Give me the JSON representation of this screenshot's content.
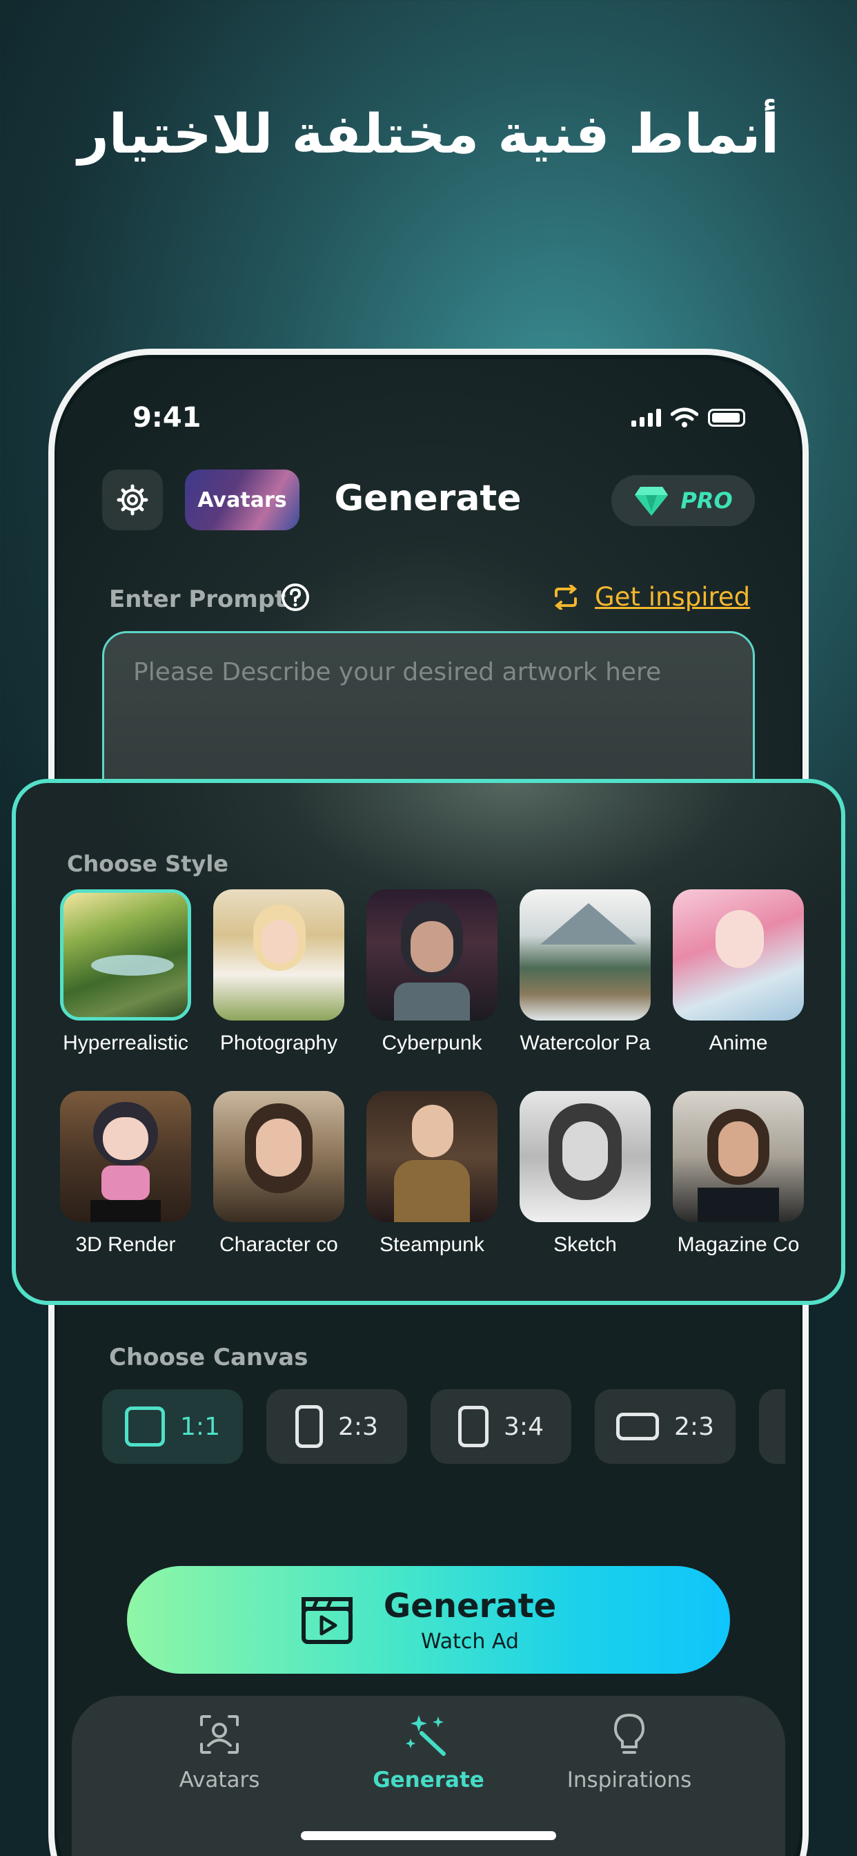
{
  "headline": "أنماط فنية مختلفة للاختيار",
  "status": {
    "time": "9:41"
  },
  "header": {
    "avatars_label": "Avatars",
    "title": "Generate",
    "pro_label": "PRO"
  },
  "prompt": {
    "label": "Enter Prompt",
    "inspire_label": "Get inspired",
    "placeholder": "Please Describe your desired artwork here"
  },
  "style": {
    "title": "Choose Style",
    "items": [
      {
        "name": "Hyperrealistic",
        "selected": true
      },
      {
        "name": "Photography"
      },
      {
        "name": "Cyberpunk"
      },
      {
        "name": "Watercolor Pa"
      },
      {
        "name": "Anime"
      },
      {
        "name": "3D Render"
      },
      {
        "name": "Character co"
      },
      {
        "name": "Steampunk"
      },
      {
        "name": "Sketch"
      },
      {
        "name": "Magazine Co"
      }
    ]
  },
  "canvas": {
    "title": "Choose Canvas",
    "options": [
      {
        "label": "1:1",
        "selected": true
      },
      {
        "label": "2:3"
      },
      {
        "label": "3:4"
      },
      {
        "label": "2:3"
      }
    ]
  },
  "generate": {
    "label": "Generate",
    "sub": "Watch Ad"
  },
  "tabs": [
    {
      "label": "Avatars",
      "icon": "avatar-icon"
    },
    {
      "label": "Generate",
      "icon": "magic-wand-icon",
      "active": true
    },
    {
      "label": "Inspirations",
      "icon": "lightbulb-icon"
    }
  ],
  "colors": {
    "accent": "#54e0c8",
    "inspire": "#f4b72d",
    "pro": "#3de3b6"
  }
}
